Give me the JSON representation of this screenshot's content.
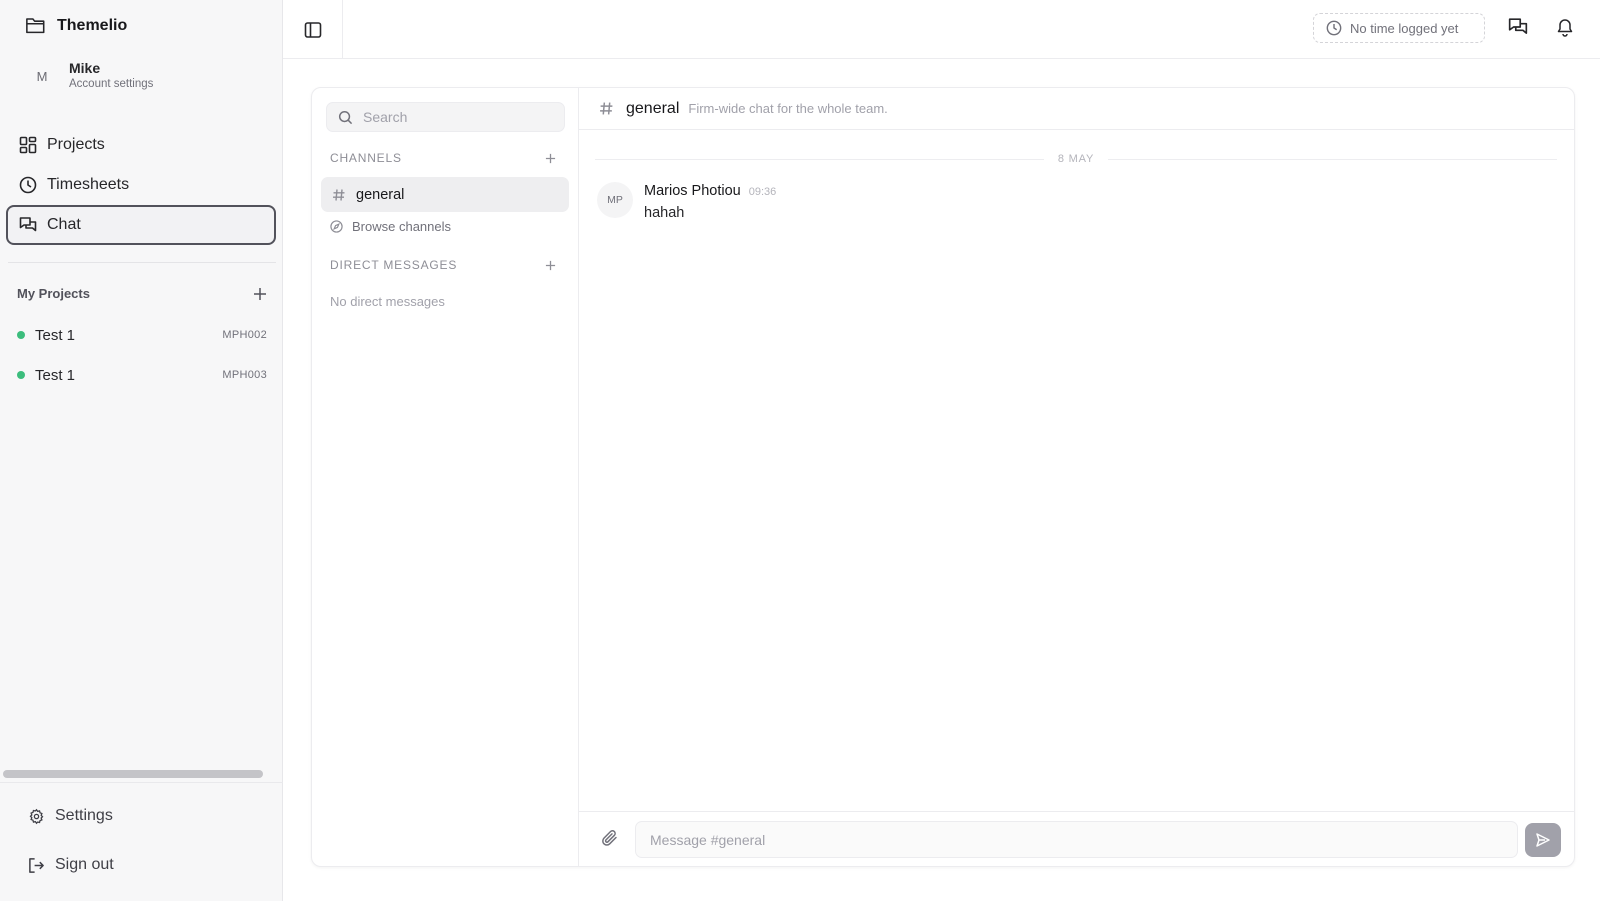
{
  "app": {
    "name": "Themelio"
  },
  "user": {
    "name": "Mike",
    "initial": "M",
    "subtitle": "Account settings"
  },
  "nav": [
    {
      "label": "Projects",
      "icon": "grid-icon"
    },
    {
      "label": "Timesheets",
      "icon": "clock-icon"
    },
    {
      "label": "Chat",
      "icon": "chat-icon",
      "active": true
    }
  ],
  "my_projects": {
    "title": "My Projects",
    "items": [
      {
        "name": "Test 1",
        "code": "MPH002",
        "status_color": "#3cbd7d"
      },
      {
        "name": "Test 1",
        "code": "MPH003",
        "status_color": "#3cbd7d"
      }
    ]
  },
  "footer": {
    "settings": "Settings",
    "signout": "Sign out"
  },
  "topbar": {
    "time_status": "No time logged yet"
  },
  "chat": {
    "search_placeholder": "Search",
    "channels_title": "CHANNELS",
    "channels": [
      {
        "name": "general",
        "active": true
      }
    ],
    "browse_label": "Browse channels",
    "dm_title": "DIRECT MESSAGES",
    "dm_empty": "No direct messages",
    "active_channel": {
      "name": "general",
      "description": "Firm-wide chat for the whole team."
    },
    "date_label": "8 MAY",
    "messages": [
      {
        "initials": "MP",
        "author": "Marios Photiou",
        "time": "09:36",
        "text": "hahah"
      }
    ],
    "composer_placeholder": "Message #general"
  },
  "colors": {
    "accent_active": "#52525b",
    "online": "#3cbd7d",
    "send_disabled": "#a1a1aa"
  }
}
